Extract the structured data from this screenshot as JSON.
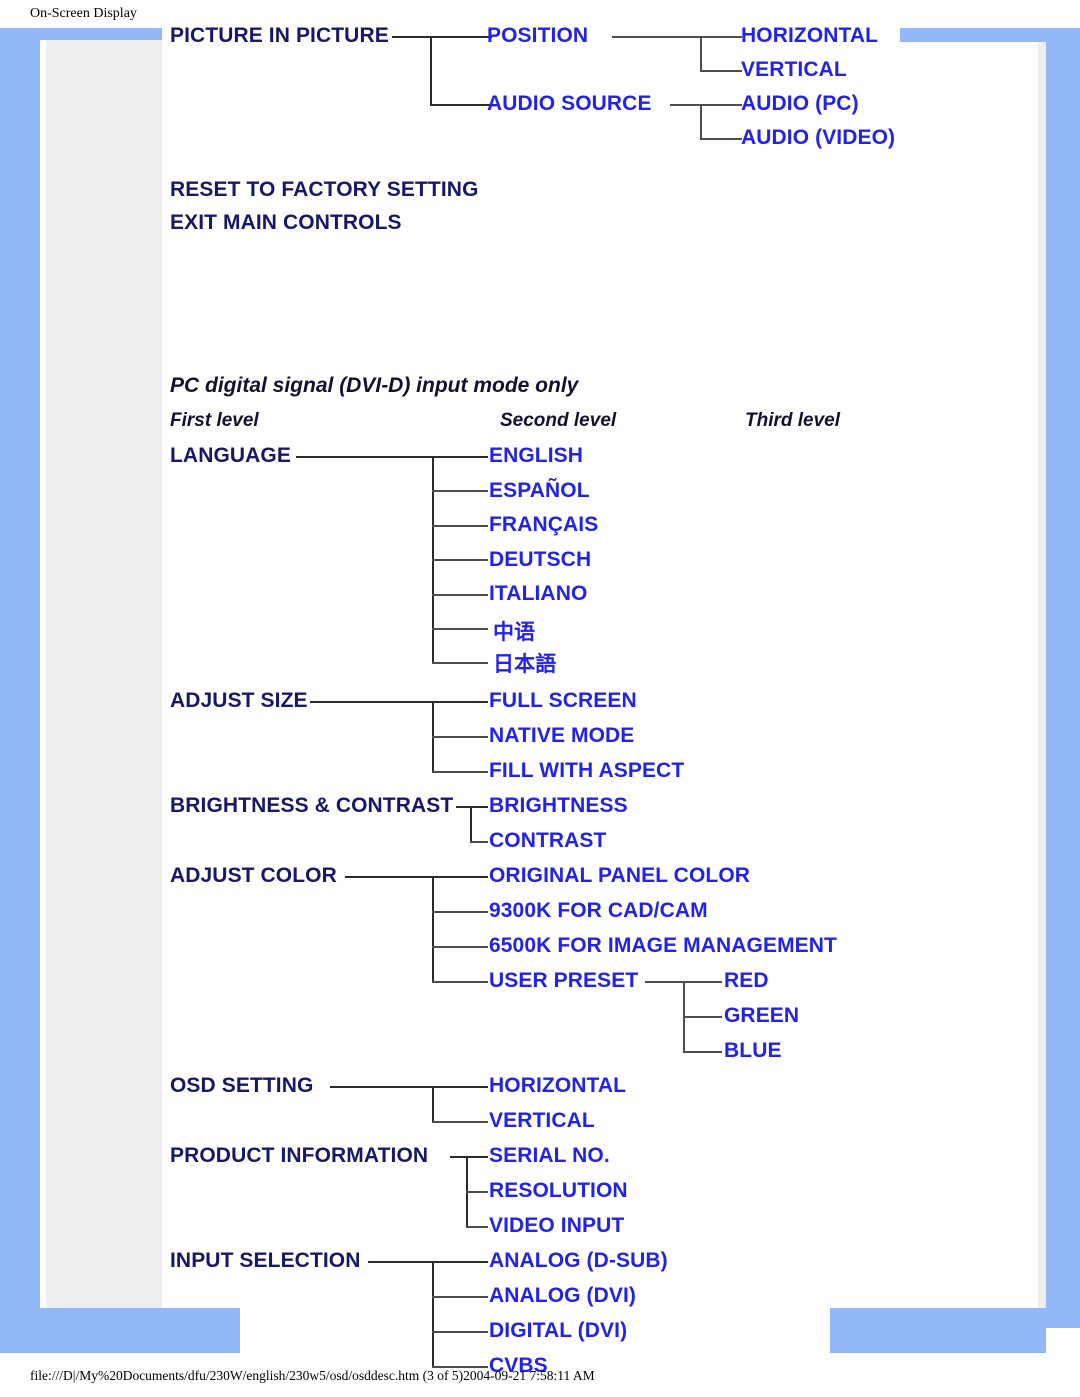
{
  "page": {
    "header": "On-Screen Display",
    "footer": "file:///D|/My%20Documents/dfu/230W/english/230w5/osd/osddesc.htm (3 of 5)2004-09-21 7:58:11 AM"
  },
  "colors": {
    "frame_blue": "#93b8f8",
    "inner_panel": "#eeeeee",
    "level1_text": "#18186b",
    "level2_text": "#2222ee",
    "connector": "#4d4d4d"
  },
  "pip_section": {
    "first": [
      {
        "label": "PICTURE IN PICTURE"
      },
      {
        "label": "RESET TO FACTORY SETTING"
      },
      {
        "label": "EXIT MAIN CONTROLS"
      }
    ],
    "second": [
      {
        "label": "POSITION"
      },
      {
        "label": "AUDIO SOURCE"
      }
    ],
    "third": [
      {
        "label": "HORIZONTAL"
      },
      {
        "label": "VERTICAL"
      },
      {
        "label": "AUDIO (PC)"
      },
      {
        "label": "AUDIO (VIDEO)"
      }
    ]
  },
  "dvi_section": {
    "title": "PC digital signal (DVI-D) input mode only",
    "columns": {
      "first": "First level",
      "second": "Second level",
      "third": "Third level"
    },
    "first": [
      {
        "label": "LANGUAGE"
      },
      {
        "label": "ADJUST SIZE"
      },
      {
        "label": "BRIGHTNESS & CONTRAST"
      },
      {
        "label": "ADJUST COLOR"
      },
      {
        "label": "OSD SETTING"
      },
      {
        "label": "PRODUCT INFORMATION"
      },
      {
        "label": "INPUT SELECTION"
      }
    ],
    "language_options": [
      {
        "label": "ENGLISH"
      },
      {
        "label": "ESPAÑOL"
      },
      {
        "label": "FRANÇAIS"
      },
      {
        "label": "DEUTSCH"
      },
      {
        "label": "ITALIANO"
      },
      {
        "label": "中语"
      },
      {
        "label": "日本語"
      }
    ],
    "adjust_size_options": [
      {
        "label": "FULL SCREEN"
      },
      {
        "label": "NATIVE MODE"
      },
      {
        "label": "FILL WITH ASPECT"
      }
    ],
    "brightness_contrast_options": [
      {
        "label": "BRIGHTNESS"
      },
      {
        "label": "CONTRAST"
      }
    ],
    "adjust_color_options": [
      {
        "label": "ORIGINAL PANEL COLOR"
      },
      {
        "label": "9300K FOR CAD/CAM"
      },
      {
        "label": "6500K FOR IMAGE MANAGEMENT"
      },
      {
        "label": "USER PRESET"
      }
    ],
    "user_preset_options": [
      {
        "label": "RED"
      },
      {
        "label": "GREEN"
      },
      {
        "label": "BLUE"
      }
    ],
    "osd_setting_options": [
      {
        "label": "HORIZONTAL"
      },
      {
        "label": "VERTICAL"
      }
    ],
    "product_information_options": [
      {
        "label": "SERIAL NO."
      },
      {
        "label": "RESOLUTION"
      },
      {
        "label": "VIDEO INPUT"
      }
    ],
    "input_selection_options": [
      {
        "label": "ANALOG (D-SUB)"
      },
      {
        "label": "ANALOG (DVI)"
      },
      {
        "label": "DIGITAL (DVI)"
      },
      {
        "label": "CVBS"
      }
    ]
  }
}
